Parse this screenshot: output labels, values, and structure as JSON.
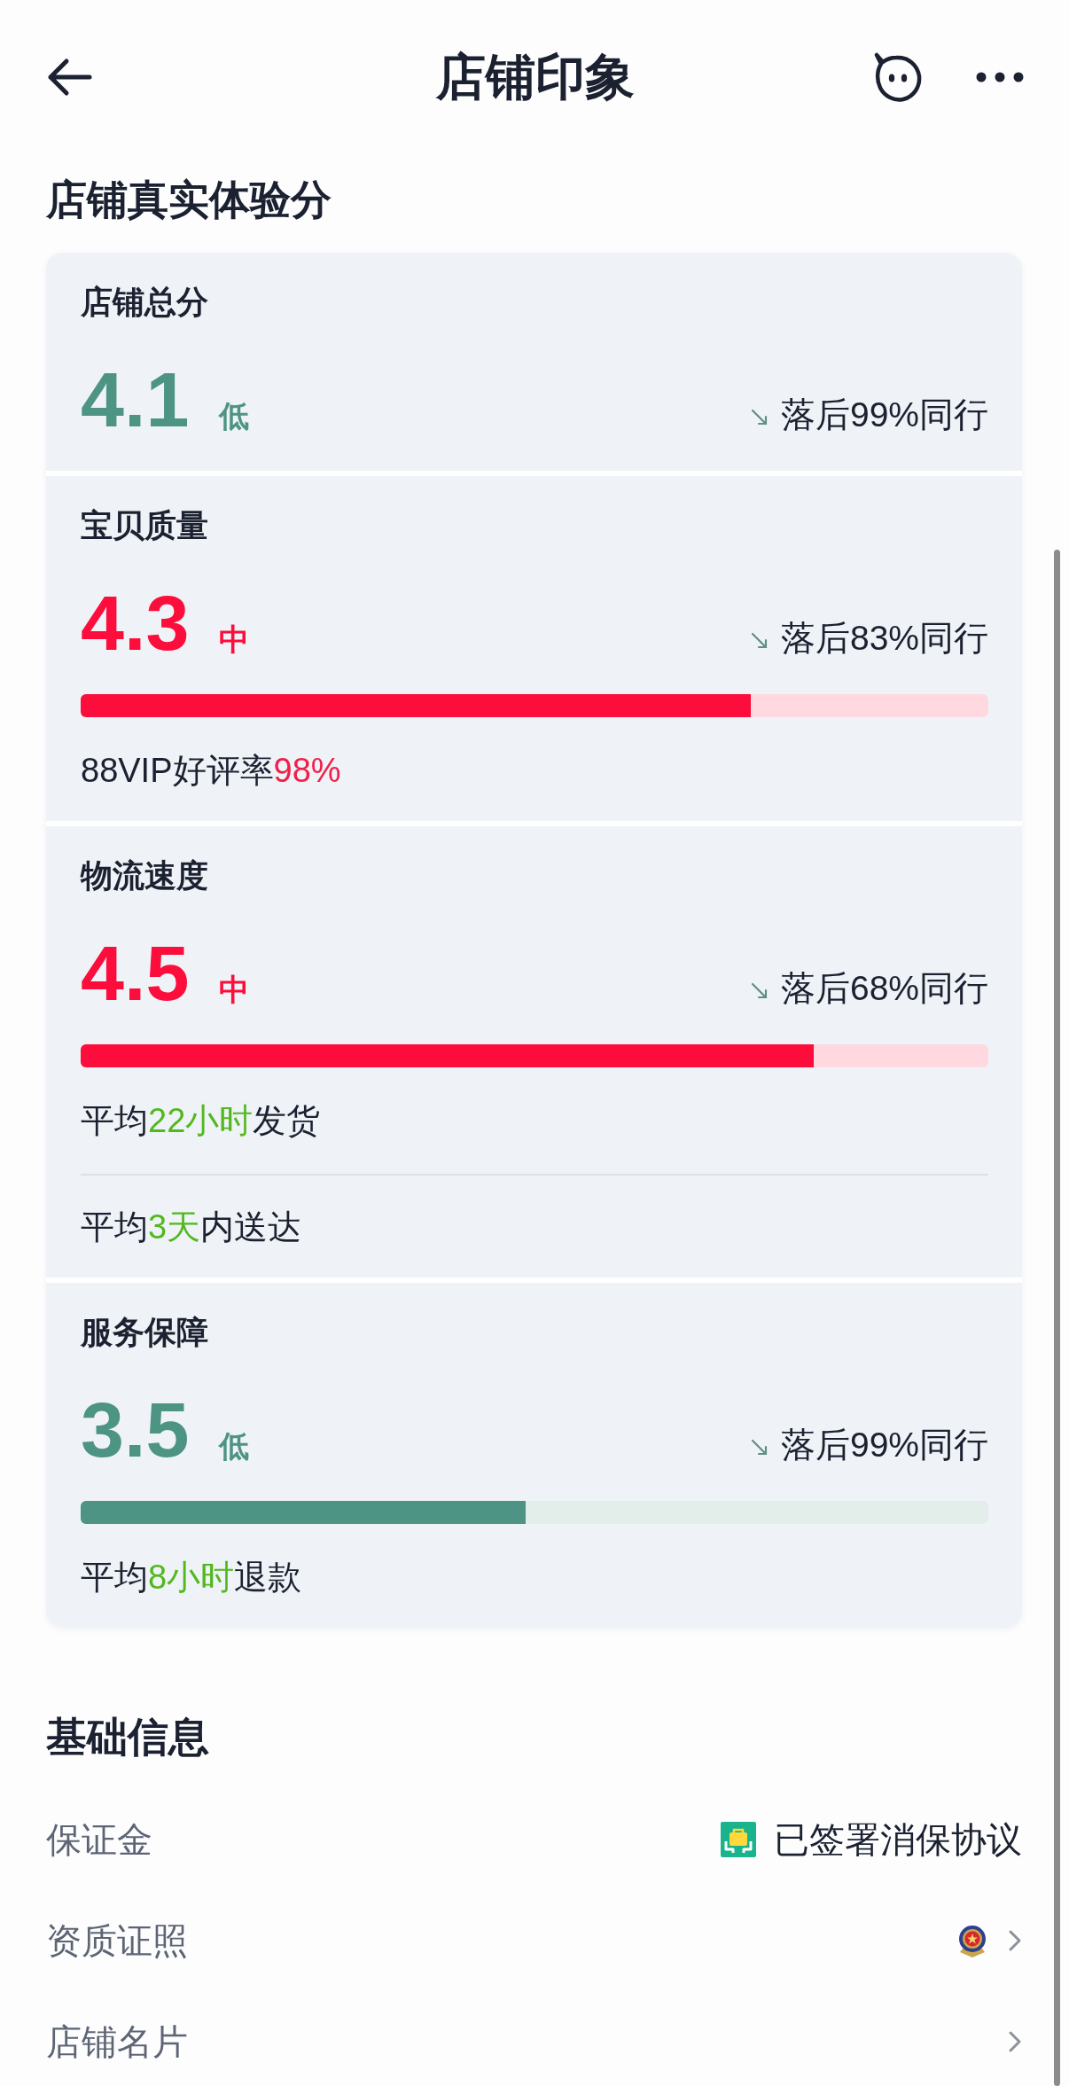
{
  "header": {
    "title": "店铺印象"
  },
  "experience_score": {
    "title": "店铺真实体验分",
    "metrics": [
      {
        "label": "店铺总分",
        "score": "4.1",
        "grade": "低",
        "color": "#4e9484",
        "comparison": "落后99%同行"
      },
      {
        "label": "宝贝质量",
        "score": "4.3",
        "grade": "中",
        "color": "#fc0d3c",
        "comparison": "落后83%同行",
        "level": 0.738,
        "details": [
          {
            "parts": [
              {
                "text": "88VIP好评率"
              },
              {
                "text": "98%",
                "color": "#f0204a"
              }
            ]
          }
        ]
      },
      {
        "label": "物流速度",
        "score": "4.5",
        "grade": "中",
        "color": "#fc0d3c",
        "comparison": "落后68%同行",
        "level": 0.808,
        "details": [
          {
            "parts": [
              {
                "text": "平均"
              },
              {
                "text": "22小时",
                "color": "#52b81e"
              },
              {
                "text": "发货"
              }
            ]
          },
          {
            "parts": [
              {
                "text": "平均"
              },
              {
                "text": "3天",
                "color": "#52b81e"
              },
              {
                "text": "内送达"
              }
            ]
          }
        ]
      },
      {
        "label": "服务保障",
        "score": "3.5",
        "grade": "低",
        "color": "#4e9484",
        "comparison": "落后99%同行",
        "level": 0.49,
        "details": [
          {
            "parts": [
              {
                "text": "平均"
              },
              {
                "text": "8小时",
                "color": "#52b81e"
              },
              {
                "text": "退款"
              }
            ]
          }
        ]
      }
    ]
  },
  "basic_info": {
    "title": "基础信息",
    "rows": [
      {
        "kind": "value",
        "label": "保证金",
        "value": "已签署消保协议"
      },
      {
        "kind": "emblem",
        "label": "资质证照"
      },
      {
        "kind": "link",
        "label": "店铺名片"
      }
    ]
  }
}
